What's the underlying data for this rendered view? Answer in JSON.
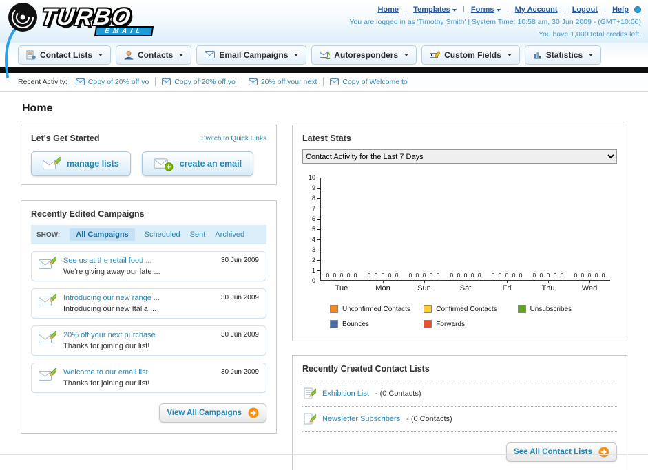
{
  "header": {
    "logo_title": "TURBO",
    "logo_subtitle": "EMAIL",
    "nav": {
      "links": [
        {
          "label": "Home"
        },
        {
          "label": "Templates"
        },
        {
          "label": "Forms"
        },
        {
          "label": "My Account"
        },
        {
          "label": "Logout"
        },
        {
          "label": "Help"
        }
      ]
    },
    "session_info": "You are logged in as 'Timothy Smith' | System Time: 10:58 am, 30 Jun 2009 - (GMT+10:00)",
    "credits_info": "You have 1,000 total credits left."
  },
  "main_nav": {
    "items": [
      {
        "label": "Contact Lists"
      },
      {
        "label": "Contacts"
      },
      {
        "label": "Email Campaigns"
      },
      {
        "label": "Autoresponders"
      },
      {
        "label": "Custom Fields"
      },
      {
        "label": "Statistics"
      }
    ]
  },
  "recent_activity": {
    "label": "Recent Activity:",
    "items": [
      {
        "text": "Copy of 20% off yo"
      },
      {
        "text": "Copy of 20% off yo"
      },
      {
        "text": "20% off your next"
      },
      {
        "text": "Copy of Welcome to"
      }
    ]
  },
  "page": {
    "title": "Home"
  },
  "get_started": {
    "title": "Let's Get Started",
    "switch_link": "Switch to Quick Links",
    "manage_lists_label": "manage lists",
    "create_email_label": "create an email"
  },
  "campaigns": {
    "title": "Recently Edited Campaigns",
    "show_label": "SHOW:",
    "filter_tabs": [
      {
        "label": "All Campaigns",
        "active": true
      },
      {
        "label": "Scheduled",
        "active": false
      },
      {
        "label": "Sent",
        "active": false
      },
      {
        "label": "Archived",
        "active": false
      }
    ],
    "items": [
      {
        "title": "See us at the retail food ...",
        "subtitle": "We're giving away our late ...",
        "date": "30 Jun 2009"
      },
      {
        "title": "Introducing our new range ...",
        "subtitle": "Introducing our new Italia ...",
        "date": "30 Jun 2009"
      },
      {
        "title": "20% off your next purchase",
        "subtitle": "Thanks for joining our list!",
        "date": "30 Jun 2009"
      },
      {
        "title": "Welcome to our email list",
        "subtitle": "Thanks for joining our list!",
        "date": "30 Jun 2009"
      }
    ],
    "view_all_label": "View All Campaigns"
  },
  "stats": {
    "title": "Latest Stats",
    "filter_value": "Contact Activity for the Last 7 Days"
  },
  "chart_data": {
    "type": "bar",
    "title": "Contact Activity for the Last 7 Days",
    "categories": [
      "Tue",
      "Mon",
      "Sun",
      "Sat",
      "Fri",
      "Thu",
      "Wed"
    ],
    "series": [
      {
        "name": "Unconfirmed Contacts",
        "color": "#f5891f",
        "values": [
          0,
          0,
          0,
          0,
          0,
          0,
          0
        ]
      },
      {
        "name": "Confirmed Contacts",
        "color": "#ffcc33",
        "values": [
          0,
          0,
          0,
          0,
          0,
          0,
          0
        ]
      },
      {
        "name": "Unsubscribes",
        "color": "#62a420",
        "values": [
          0,
          0,
          0,
          0,
          0,
          0,
          0
        ]
      },
      {
        "name": "Bounces",
        "color": "#4a6da7",
        "values": [
          0,
          0,
          0,
          0,
          0,
          0,
          0
        ]
      },
      {
        "name": "Forwards",
        "color": "#e8502a",
        "values": [
          0,
          0,
          0,
          0,
          0,
          0,
          0
        ]
      }
    ],
    "ylim": [
      0,
      10
    ],
    "ytick_step": 1,
    "grid": false,
    "legend_position": "bottom"
  },
  "contact_lists": {
    "title": "Recently Created Contact Lists",
    "items": [
      {
        "name": "Exhibition List",
        "suffix": "- (0 Contacts)"
      },
      {
        "name": "Newsletter Subscribers",
        "suffix": "- (0 Contacts)"
      }
    ],
    "see_all_label": "See All Contact Lists"
  }
}
